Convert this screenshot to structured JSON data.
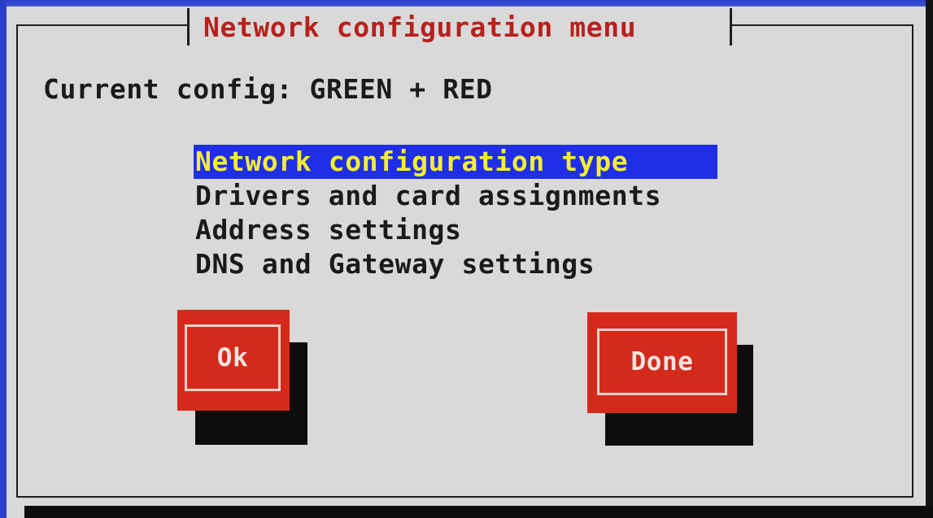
{
  "dialog": {
    "title": "Network configuration menu",
    "current_config_label": "Current config:",
    "current_config_value": "GREEN + RED"
  },
  "menu": {
    "items": [
      {
        "label": "Network configuration type",
        "selected": true
      },
      {
        "label": "Drivers and card assignments",
        "selected": false
      },
      {
        "label": "Address settings",
        "selected": false
      },
      {
        "label": "DNS and Gateway settings",
        "selected": false
      }
    ]
  },
  "buttons": {
    "ok_label": "Ok",
    "done_label": "Done"
  },
  "colors": {
    "background": "#d9d9d9",
    "title_text": "#b8201c",
    "selection_bg": "#1f2fe8",
    "selection_text": "#f5ee30",
    "button_bg": "#d42a1c",
    "button_text": "#f3e3df",
    "shadow": "#0d0d0d",
    "screen_edge": "#2a3fc8"
  }
}
